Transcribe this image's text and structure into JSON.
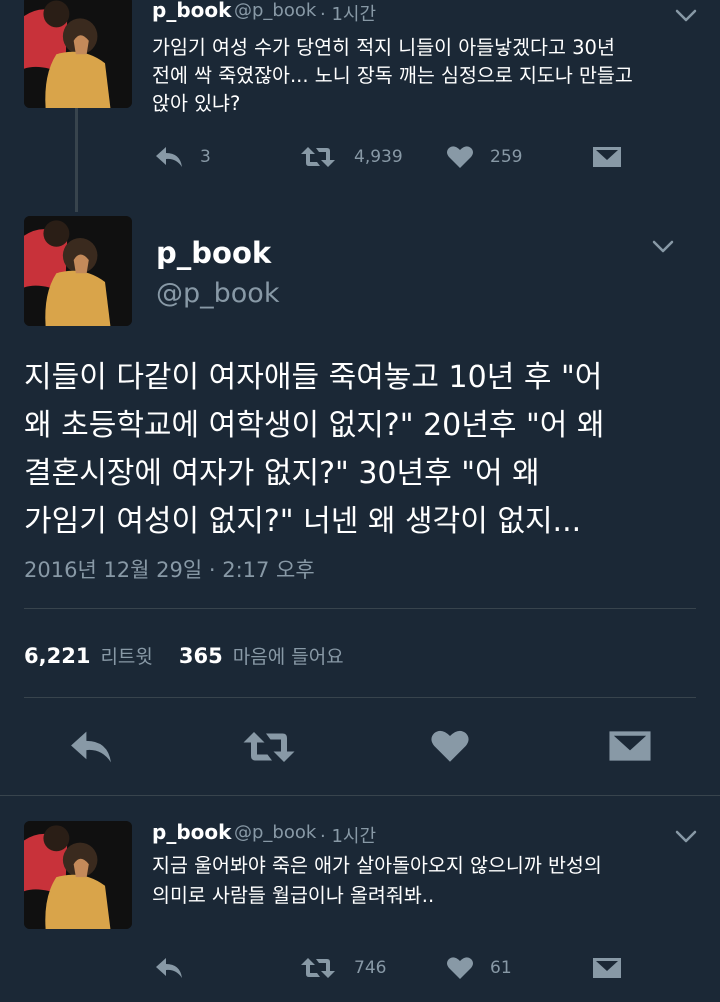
{
  "tweet1": {
    "name": "p_book",
    "handle": "@p_book",
    "time": "· 1시간",
    "text": [
      "가임기 여성 수가 당연히 적지 니들이 아들낳겠다고 30년",
      "전에 싹 죽였잖아... 노니 장독 깨는 심정으로 지도나 만들고",
      "앉아 있냐?"
    ],
    "replies": "3",
    "retweets": "4,939",
    "likes": "259"
  },
  "main": {
    "name": "p_book",
    "handle": "@p_book",
    "text": [
      "지들이 다같이 여자애들 죽여놓고 10년 후 \"어",
      "왜 초등학교에 여학생이 없지?\" 20년후 \"어 왜",
      "결혼시장에 여자가 없지?\" 30년후 \"어 왜",
      "가임기 여성이 없지?\" 너넨 왜 생각이 없지..."
    ],
    "timestamp": "2016년 12월 29일 · 2:17 오후",
    "retweet_count": "6,221",
    "retweet_label": "리트윗",
    "like_count": "365",
    "like_label": "마음에 들어요"
  },
  "tweet3": {
    "name": "p_book",
    "handle": "@p_book",
    "time": "· 1시간",
    "text": [
      "지금 울어봐야 죽은 애가 살아돌아오지 않으니까 반성의",
      "의미로 사람들 월급이나 올려줘봐.."
    ],
    "retweets": "746",
    "likes": "61"
  },
  "icons": {
    "reply": "reply-icon",
    "retweet": "retweet-icon",
    "like": "heart-icon",
    "dm": "dm-envelope-icon",
    "more": "chevron-down-icon"
  },
  "colors": {
    "background": "#1b2836",
    "muted": "#8899a6",
    "divider": "#38444d"
  }
}
